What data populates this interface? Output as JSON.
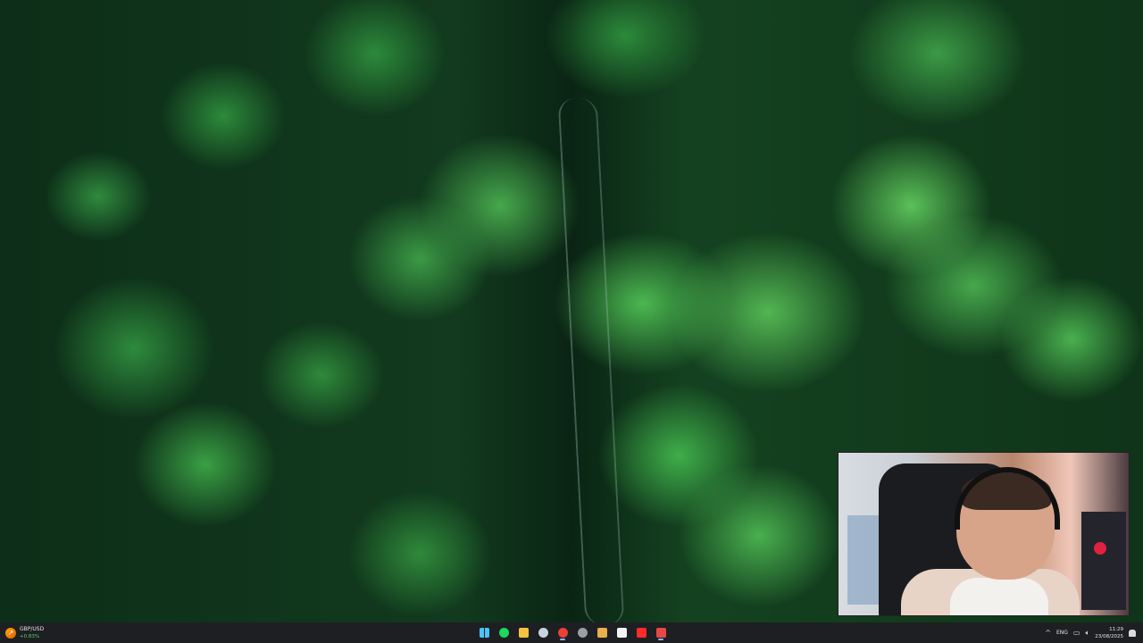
{
  "widget": {
    "title": "GBP/USD",
    "change": "+0.83%"
  },
  "taskbar": {
    "apps": [
      {
        "name": "start",
        "color": "#4cc2ff"
      },
      {
        "name": "spotify",
        "color": "#1ed760"
      },
      {
        "name": "file-explorer",
        "color": "#f5c242"
      },
      {
        "name": "steam",
        "color": "#c7d5e0"
      },
      {
        "name": "chrome",
        "color": "#e94235"
      },
      {
        "name": "app-grey",
        "color": "#9aa0a6"
      },
      {
        "name": "app-shield",
        "color": "#e8b04a"
      },
      {
        "name": "microsoft-store",
        "color": "#f3f3f3"
      },
      {
        "name": "youtube",
        "color": "#ff2a2a"
      },
      {
        "name": "app-red",
        "color": "#e54848"
      }
    ]
  },
  "tray": {
    "chevron": "^",
    "language": "ENG",
    "time": "11:29",
    "date": "23/08/2025"
  }
}
